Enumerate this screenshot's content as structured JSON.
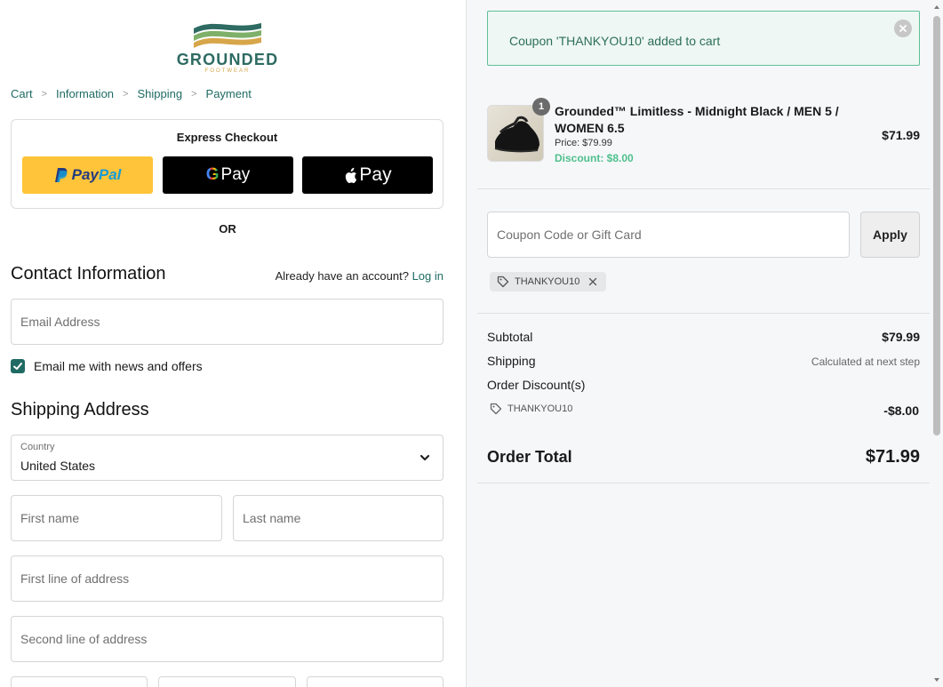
{
  "brand": {
    "name": "GROUNDED",
    "sub": "FOOTWEAR"
  },
  "breadcrumb": [
    "Cart",
    "Information",
    "Shipping",
    "Payment"
  ],
  "express": {
    "title": "Express Checkout",
    "paypal_a": "Pay",
    "paypal_b": "Pal",
    "gpay": "Pay",
    "apay": "Pay"
  },
  "or_label": "OR",
  "contact": {
    "title": "Contact Information",
    "account_prompt": "Already have an account?",
    "login": "Log in",
    "email_placeholder": "Email Address",
    "newsletter_label": "Email me with news and offers",
    "newsletter_checked": true
  },
  "shipping": {
    "title": "Shipping Address",
    "country_label": "Country",
    "country_value": "United States",
    "first_name_placeholder": "First name",
    "last_name_placeholder": "Last name",
    "address1_placeholder": "First line of address",
    "address2_placeholder": "Second line of address"
  },
  "alert": {
    "message": "Coupon 'THANKYOU10' added to cart"
  },
  "product": {
    "quantity": "1",
    "name": "Grounded™ Limitless - Midnight Black / MEN 5 / WOMEN 6.5",
    "price": "Price: $79.99",
    "discount": "Discount: $8.00",
    "total": "$71.99"
  },
  "coupon": {
    "placeholder": "Coupon Code or Gift Card",
    "apply": "Apply",
    "applied_code": "THANKYOU10"
  },
  "summary": {
    "subtotal_label": "Subtotal",
    "subtotal_value": "$79.99",
    "shipping_label": "Shipping",
    "shipping_value": "Calculated at next step",
    "discount_label": "Order Discount(s)",
    "discount_code": "THANKYOU10",
    "discount_value": "-$8.00",
    "total_label": "Order Total",
    "total_value": "$71.99"
  },
  "colors": {
    "accent": "#1f6b63",
    "success": "#4fc08d",
    "paypal": "#ffc439"
  }
}
